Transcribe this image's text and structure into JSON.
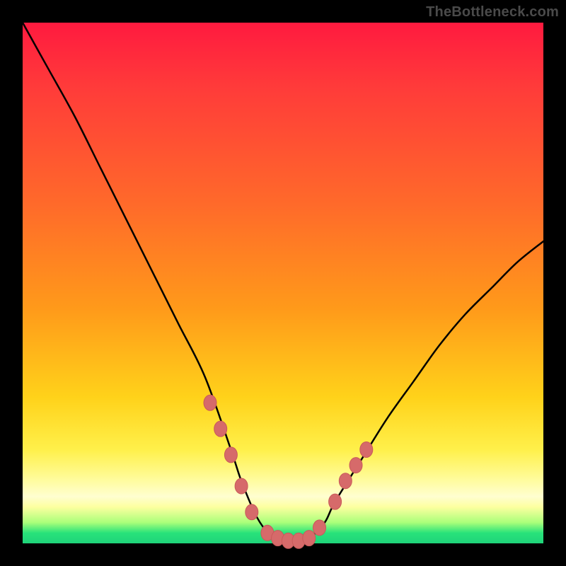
{
  "watermark": "TheBottleneck.com",
  "colors": {
    "frame": "#000000",
    "curve": "#000000",
    "marker_fill": "#d66a6a",
    "marker_stroke": "#c85a5a",
    "gradient_top": "#ff1a3f",
    "gradient_bottom": "#1fd47a"
  },
  "chart_data": {
    "type": "line",
    "title": "",
    "xlabel": "",
    "ylabel": "",
    "xlim": [
      0,
      100
    ],
    "ylim": [
      0,
      100
    ],
    "x": [
      0,
      5,
      10,
      15,
      20,
      25,
      30,
      35,
      40,
      42,
      45,
      48,
      50,
      52,
      55,
      58,
      60,
      65,
      70,
      75,
      80,
      85,
      90,
      95,
      100
    ],
    "y": [
      100,
      91,
      82,
      72,
      62,
      52,
      42,
      32,
      18,
      12,
      5,
      1,
      0,
      0,
      1,
      4,
      8,
      16,
      24,
      31,
      38,
      44,
      49,
      54,
      58
    ],
    "markers": [
      {
        "x": 36,
        "y": 27
      },
      {
        "x": 38,
        "y": 22
      },
      {
        "x": 40,
        "y": 17
      },
      {
        "x": 42,
        "y": 11
      },
      {
        "x": 44,
        "y": 6
      },
      {
        "x": 47,
        "y": 2
      },
      {
        "x": 49,
        "y": 1
      },
      {
        "x": 51,
        "y": 0.5
      },
      {
        "x": 53,
        "y": 0.5
      },
      {
        "x": 55,
        "y": 1
      },
      {
        "x": 57,
        "y": 3
      },
      {
        "x": 60,
        "y": 8
      },
      {
        "x": 62,
        "y": 12
      },
      {
        "x": 64,
        "y": 15
      },
      {
        "x": 66,
        "y": 18
      }
    ]
  }
}
